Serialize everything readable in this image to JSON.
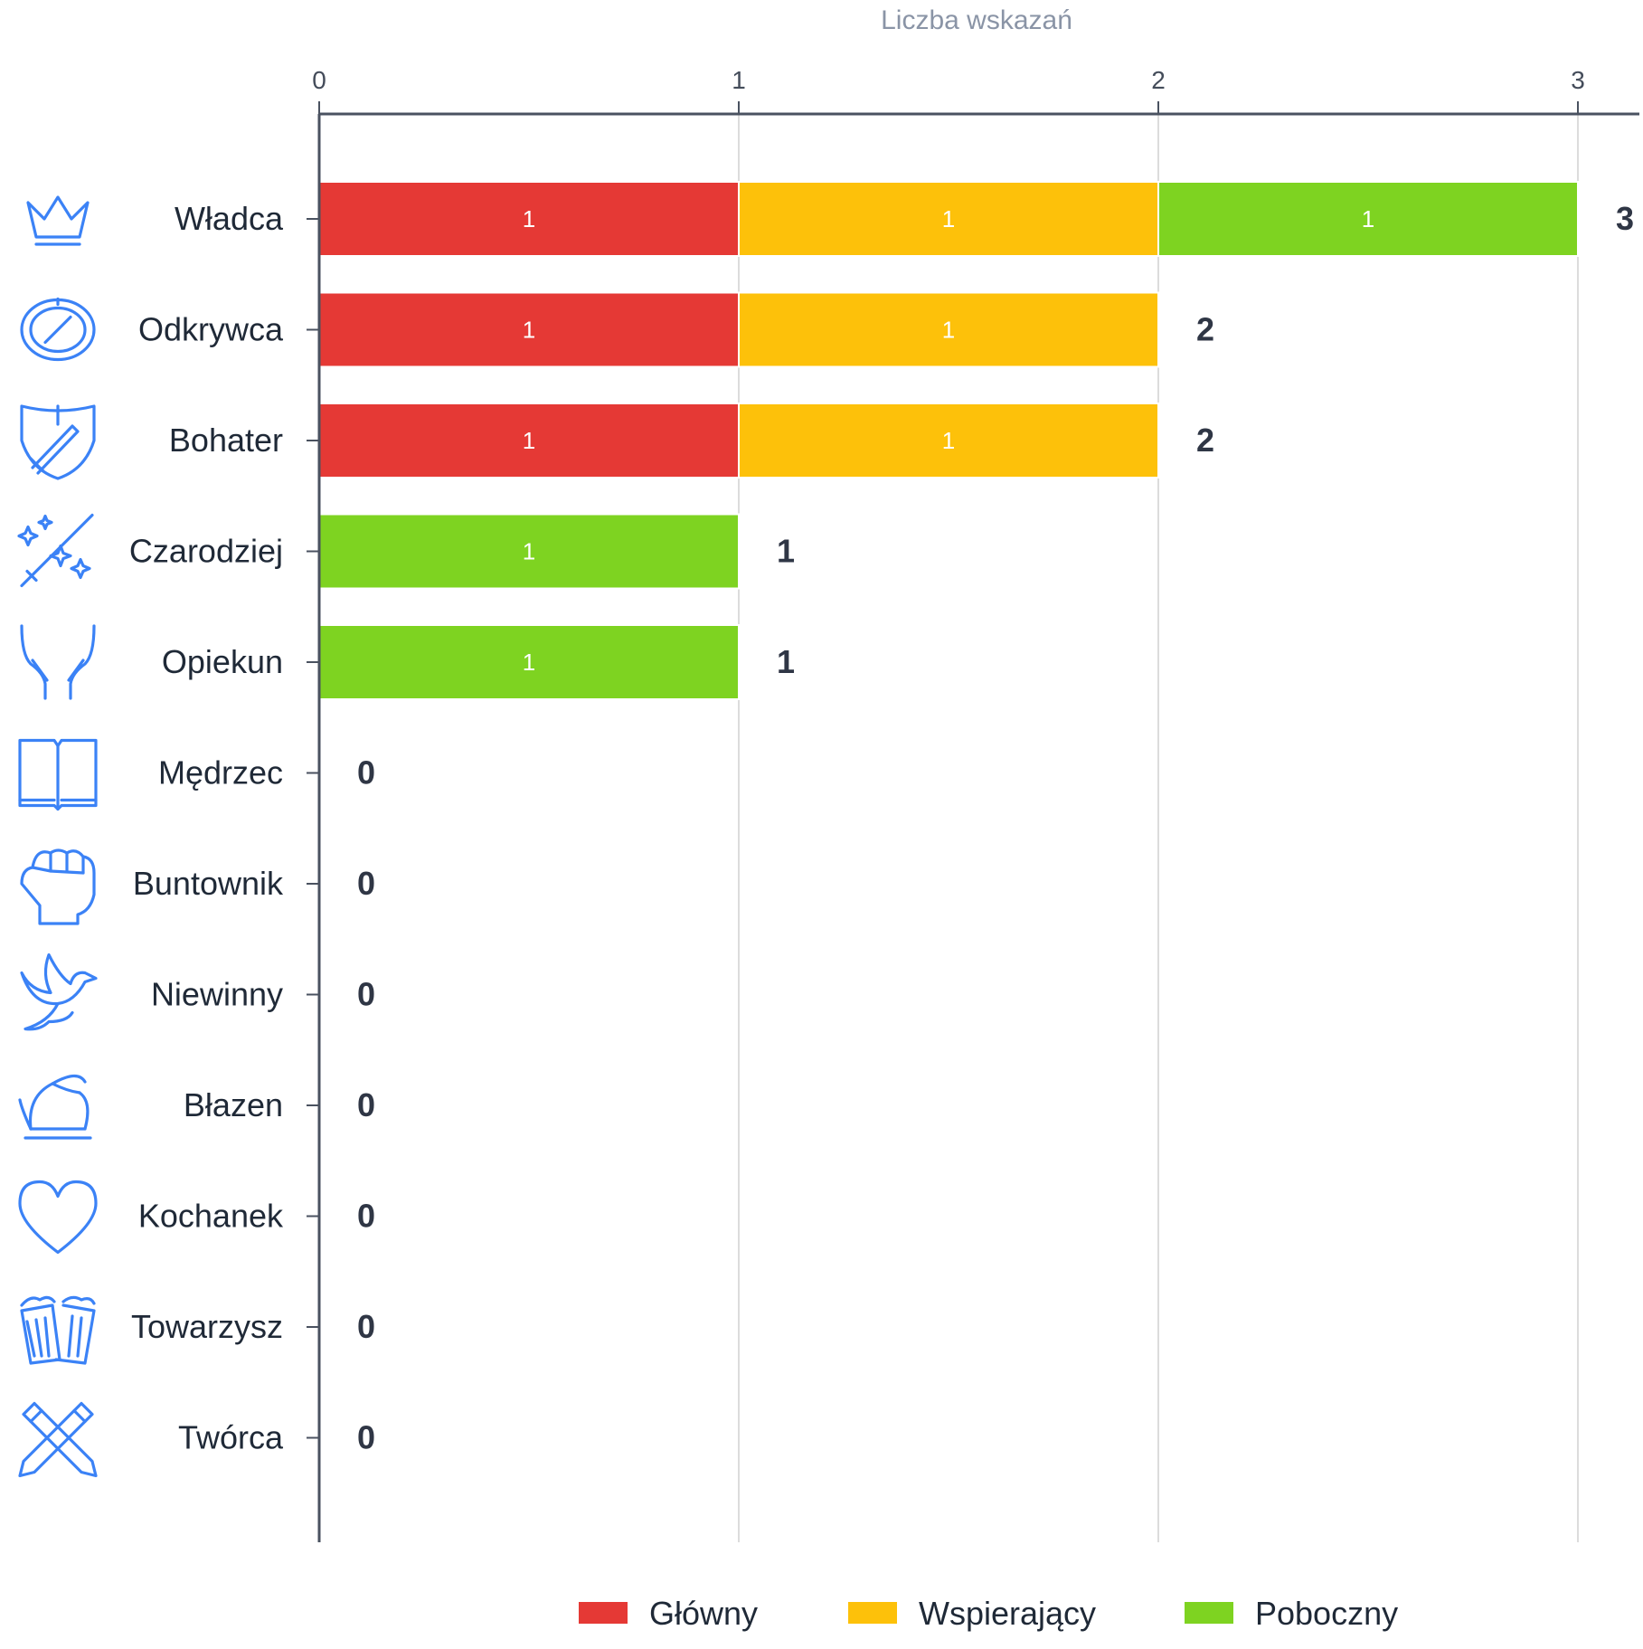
{
  "chart_data": {
    "type": "bar",
    "orientation": "horizontal",
    "stacked": true,
    "title": "",
    "xlabel": "Liczba wskazań",
    "ylabel": "",
    "xlim": [
      0,
      3
    ],
    "x_ticks": [
      "0",
      "1",
      "2",
      "3"
    ],
    "grid": true,
    "legend_position": "bottom",
    "categories": [
      "Władca",
      "Odkrywca",
      "Bohater",
      "Czarodziej",
      "Opiekun",
      "Mędrzec",
      "Buntownik",
      "Niewinny",
      "Błazen",
      "Kochanek",
      "Towarzysz",
      "Twórca"
    ],
    "category_icons": [
      "crown-icon",
      "compass-icon",
      "shield-sword-icon",
      "magic-wand-icon",
      "caring-hands-icon",
      "open-book-icon",
      "raised-fist-icon",
      "dove-icon",
      "jester-hat-icon",
      "heart-icon",
      "beer-mugs-icon",
      "crossed-pencils-icon"
    ],
    "series": [
      {
        "name": "Główny",
        "color": "#e53935",
        "values": [
          1,
          1,
          1,
          0,
          0,
          0,
          0,
          0,
          0,
          0,
          0,
          0
        ]
      },
      {
        "name": "Wspierający",
        "color": "#fdc10a",
        "values": [
          1,
          1,
          1,
          0,
          0,
          0,
          0,
          0,
          0,
          0,
          0,
          0
        ]
      },
      {
        "name": "Poboczny",
        "color": "#7ed321",
        "values": [
          1,
          0,
          0,
          1,
          1,
          0,
          0,
          0,
          0,
          0,
          0,
          0
        ]
      }
    ],
    "totals": [
      "3",
      "2",
      "2",
      "1",
      "1",
      "0",
      "0",
      "0",
      "0",
      "0",
      "0",
      "0"
    ]
  }
}
